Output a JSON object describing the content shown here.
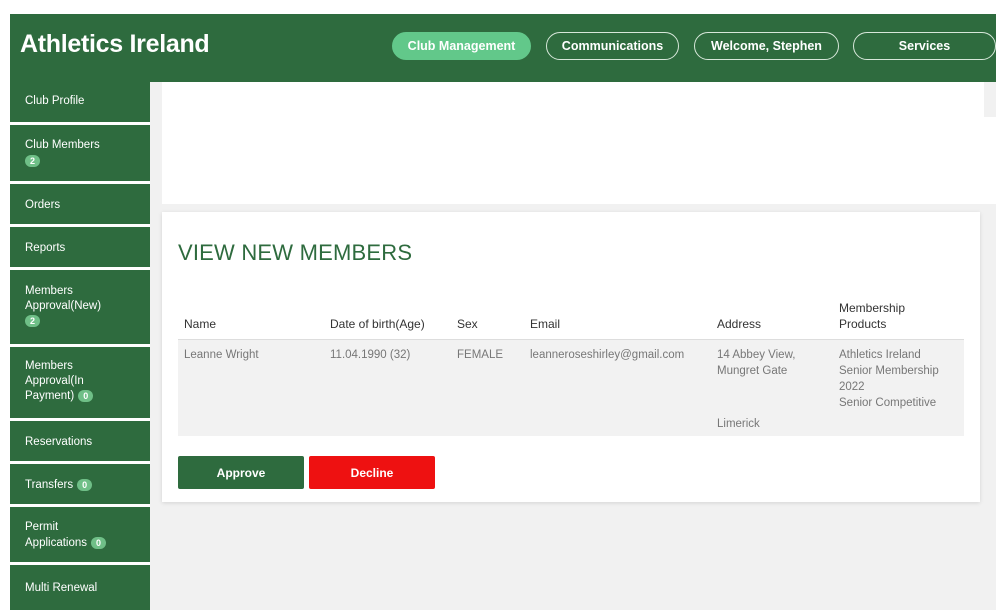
{
  "header": {
    "brand": "Athletics Ireland",
    "nav": [
      {
        "label": "Club Management",
        "active": true
      },
      {
        "label": "Communications",
        "active": false
      },
      {
        "label": "Welcome, Stephen",
        "active": false
      },
      {
        "label": "Services",
        "active": false
      }
    ]
  },
  "sidebar": {
    "items": [
      {
        "label": "Club Profile"
      },
      {
        "label": "Club Members",
        "badge": "2"
      },
      {
        "label": "Orders"
      },
      {
        "label": "Reports"
      },
      {
        "label_line1": "Members",
        "label_line2": "Approval(New)",
        "badge": "2"
      },
      {
        "label_line1": "Members",
        "label_line2": "Approval(In",
        "label_line3": "Payment)",
        "badge": "0"
      },
      {
        "label": "Reservations"
      },
      {
        "label": "Transfers",
        "badge": "0"
      },
      {
        "label_line1": "Permit",
        "label_line2": "Applications",
        "badge": "0"
      },
      {
        "label": "Multi Renewal"
      }
    ]
  },
  "main": {
    "title": "VIEW NEW MEMBERS",
    "columns": {
      "name": "Name",
      "dob": "Date of birth(Age)",
      "sex": "Sex",
      "email": "Email",
      "address": "Address",
      "membership_line1": "Membership",
      "membership_line2": "Products"
    },
    "rows": [
      {
        "name": "Leanne Wright",
        "dob": "11.04.1990 (32)",
        "sex": "FEMALE",
        "email": "leanneroseshirley@gmail.com",
        "address_line1": "14 Abbey View,",
        "address_line2": "Mungret Gate",
        "address_line3": "Limerick",
        "membership_line1": "Athletics Ireland",
        "membership_line2": "Senior Membership",
        "membership_line3": "2022",
        "membership_line4": "Senior Competitive"
      }
    ],
    "actions": {
      "approve": "Approve",
      "decline": "Decline"
    }
  },
  "colors": {
    "brand_green": "#2e6b3e",
    "active_nav": "#62c88a",
    "badge": "#6fbf87",
    "decline_red": "#ee1111",
    "title_green": "#2e6b3e"
  }
}
